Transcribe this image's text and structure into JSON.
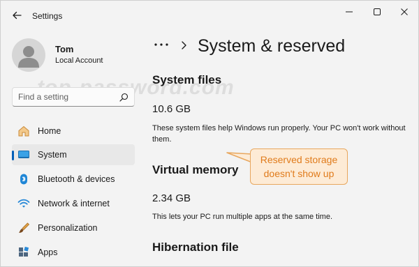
{
  "window": {
    "title": "Settings"
  },
  "profile": {
    "name": "Tom",
    "account": "Local Account"
  },
  "search": {
    "placeholder": "Find a setting"
  },
  "watermark": "top-password.com",
  "sidebar": {
    "items": [
      {
        "label": "Home",
        "icon": "home-icon"
      },
      {
        "label": "System",
        "icon": "monitor-icon",
        "selected": true
      },
      {
        "label": "Bluetooth & devices",
        "icon": "bluetooth-icon"
      },
      {
        "label": "Network & internet",
        "icon": "wifi-icon"
      },
      {
        "label": "Personalization",
        "icon": "brush-icon"
      },
      {
        "label": "Apps",
        "icon": "apps-icon"
      }
    ]
  },
  "breadcrumb": {
    "more": "•••",
    "title": "System & reserved"
  },
  "sections": [
    {
      "title": "System files",
      "size": "10.6 GB",
      "description": "These system files help Windows run properly. Your PC won't work without them."
    },
    {
      "title": "Virtual memory",
      "size": "2.34 GB",
      "description": "This lets your PC run multiple apps at the same time."
    },
    {
      "title": "Hibernation file"
    }
  ],
  "callout": {
    "text": "Reserved storage doesn't show up"
  },
  "colors": {
    "accent": "#005fb8",
    "callout_fill": "#fdebd6",
    "callout_border": "#e8a75e",
    "callout_text": "#e07b1b"
  }
}
